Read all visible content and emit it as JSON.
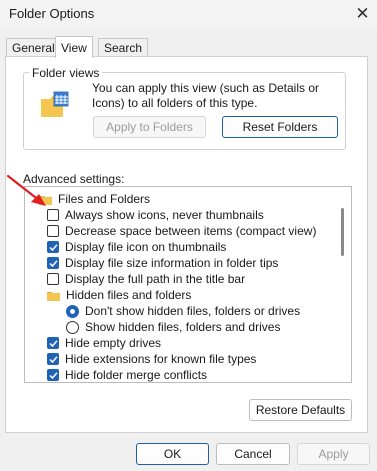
{
  "window": {
    "title": "Folder Options",
    "close_glyph": "✕"
  },
  "tabs": [
    {
      "label": "General",
      "active": false
    },
    {
      "label": "View",
      "active": true
    },
    {
      "label": "Search",
      "active": false
    }
  ],
  "folder_views": {
    "group_label": "Folder views",
    "description": "You can apply this view (such as Details or Icons) to all folders of this type.",
    "apply_button": "Apply to Folders",
    "reset_button": "Reset Folders",
    "icon": "folder-details-icon"
  },
  "advanced": {
    "label": "Advanced settings:",
    "items": [
      {
        "type": "folder",
        "label": "Files and Folders",
        "icon": "folder-icon"
      },
      {
        "type": "checkbox",
        "label": "Always show icons, never thumbnails",
        "checked": false
      },
      {
        "type": "checkbox",
        "label": "Decrease space between items (compact view)",
        "checked": false
      },
      {
        "type": "checkbox",
        "label": "Display file icon on thumbnails",
        "checked": true
      },
      {
        "type": "checkbox",
        "label": "Display file size information in folder tips",
        "checked": true
      },
      {
        "type": "checkbox",
        "label": "Display the full path in the title bar",
        "checked": false
      },
      {
        "type": "folder",
        "label": "Hidden files and folders",
        "icon": "folder-icon"
      },
      {
        "type": "radio",
        "label": "Don't show hidden files, folders or drives",
        "checked": true
      },
      {
        "type": "radio",
        "label": "Show hidden files, folders and drives",
        "checked": false
      },
      {
        "type": "checkbox",
        "label": "Hide empty drives",
        "checked": true
      },
      {
        "type": "checkbox",
        "label": "Hide extensions for known file types",
        "checked": true
      },
      {
        "type": "checkbox",
        "label": "Hide folder merge conflicts",
        "checked": true
      }
    ]
  },
  "restore_button": "Restore Defaults",
  "footer": {
    "ok": "OK",
    "cancel": "Cancel",
    "apply": "Apply"
  },
  "colors": {
    "accent": "#1f63b8",
    "annotation_arrow": "#e0201f"
  }
}
